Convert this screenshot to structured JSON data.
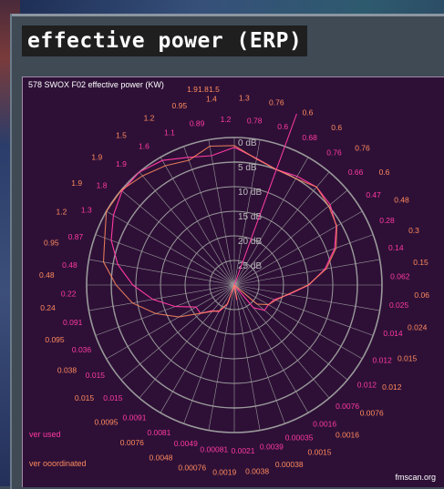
{
  "page": {
    "heading": "effective power (ERP)"
  },
  "chart_data": {
    "type": "polar",
    "title": "578 SWOX F02 effective power (KW)",
    "rings_db": [
      "0 dB",
      "5 dB",
      "10 dB",
      "15 dB",
      "20 dB",
      "25 dB"
    ],
    "legend": {
      "used": "ver used",
      "coordinated": "ver ooordinated"
    },
    "credit": "fmscan.org",
    "colors": {
      "background": "#2e1037",
      "grid": "#9a9a9a",
      "used": "#ff3aa0",
      "coordinated": "#ff8a5c",
      "ring_labels": "#bdbdbd"
    },
    "azimuth_step_deg": 10,
    "used_labels": [
      "1.2",
      "0.78",
      "0.6",
      "0.68",
      "0.76",
      "0.66",
      "0.47",
      "0.28",
      "0.14",
      "0.062",
      "0.025",
      "0.014",
      "0.012",
      "0.012",
      "0.0076",
      "0.0016",
      "0.00035",
      "0.0039",
      "0.0021",
      "0.00081",
      "0.0049",
      "0.0081",
      "0.0091",
      "0.015",
      "0.015",
      "0.036",
      "0.091",
      "0.22",
      "0.48",
      "0.87",
      "1.3",
      "1.8",
      "1.9",
      "1.6",
      "1.1",
      "0.89"
    ],
    "coordinated_labels": [
      "1.3",
      "0.76",
      "0.6",
      "0.6",
      "0.76",
      "0.6",
      "0.48",
      "0.3",
      "0.15",
      "0.06",
      "0.024",
      "0.015",
      "0.012",
      "0.0076",
      "0.0016",
      "0.0015",
      "0.00038",
      "0.0038",
      "0.0019",
      "0.00076",
      "0.0048",
      "0.0076",
      "0.0095",
      "0.015",
      "0.038",
      "0.095",
      "0.24",
      "0.48",
      "0.95",
      "1.2",
      "1.9",
      "1.9",
      "1.5",
      "1.2",
      "0.95",
      "1.4"
    ],
    "inner_labels": [
      "1.9",
      "1.8",
      "1.5"
    ],
    "series": [
      {
        "name": "ver used",
        "values_kw": [
          1.2,
          0.78,
          0.6,
          0.68,
          0.76,
          0.66,
          0.47,
          0.28,
          0.14,
          0.062,
          0.025,
          0.014,
          0.012,
          0.012,
          0.0076,
          0.0016,
          0.00035,
          0.0039,
          0.0021,
          0.00081,
          0.0049,
          0.0081,
          0.0091,
          0.015,
          0.015,
          0.036,
          0.091,
          0.22,
          0.48,
          0.87,
          1.3,
          1.8,
          1.9,
          1.6,
          1.1,
          0.89
        ]
      },
      {
        "values_kw": [
          1.3,
          0.76,
          0.6,
          0.6,
          0.76,
          0.6,
          0.48,
          0.3,
          0.15,
          0.06,
          0.024,
          0.015,
          0.012,
          0.0076,
          0.0016,
          0.0015,
          0.00038,
          0.0038,
          0.0019,
          0.00076,
          0.0048,
          0.0076,
          0.0095,
          0.015,
          0.038,
          0.095,
          0.24,
          0.48,
          0.95,
          1.2,
          1.9,
          1.9,
          1.5,
          1.2,
          0.95,
          1.4
        ]
      }
    ],
    "main_beam_azimuth_deg": 20
  }
}
